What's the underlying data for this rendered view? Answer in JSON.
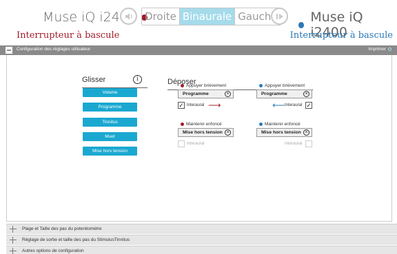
{
  "header": {
    "left_device": "Muse iQ i2400",
    "right_device": "Muse iQ i2400",
    "left_subtitle": "Interrupteur à bascule",
    "right_subtitle": "Interrupteur à bascule",
    "sides": [
      "Droite",
      "Binaurale",
      "Gauche"
    ],
    "active_side": "Binaurale",
    "left_color": "#a01c2a",
    "right_color": "#2a78b6",
    "speaker_icon": "speaker-icon",
    "play_icon": "play-icon"
  },
  "section": {
    "title": "Configuration des réglages utilisateur",
    "print_label": "Imprimer"
  },
  "drag": {
    "title": "Glisser",
    "items": [
      "Volume",
      "Programme",
      "Tinnitus",
      "Muet",
      "Mise hors tension"
    ]
  },
  "drop": {
    "title": "Déposer",
    "short_press": {
      "label": "Appuyer brièvement",
      "left_value": "Programme",
      "right_value": "Programme",
      "interaural": "Interaural",
      "interaural_checked": true
    },
    "long_press": {
      "label": "Maintenir enfoncé",
      "left_value": "Mise hors tension",
      "right_value": "Mise hors tension",
      "interaural": "Interaural",
      "interaural_checked": false
    }
  },
  "accordions": [
    "Plage et Taille des pas du potentiomètre",
    "Réglage de sortie et taille des pas du StimulusTinnitus",
    "Autres options de configuration"
  ],
  "accent_color": "#1aa8d1"
}
